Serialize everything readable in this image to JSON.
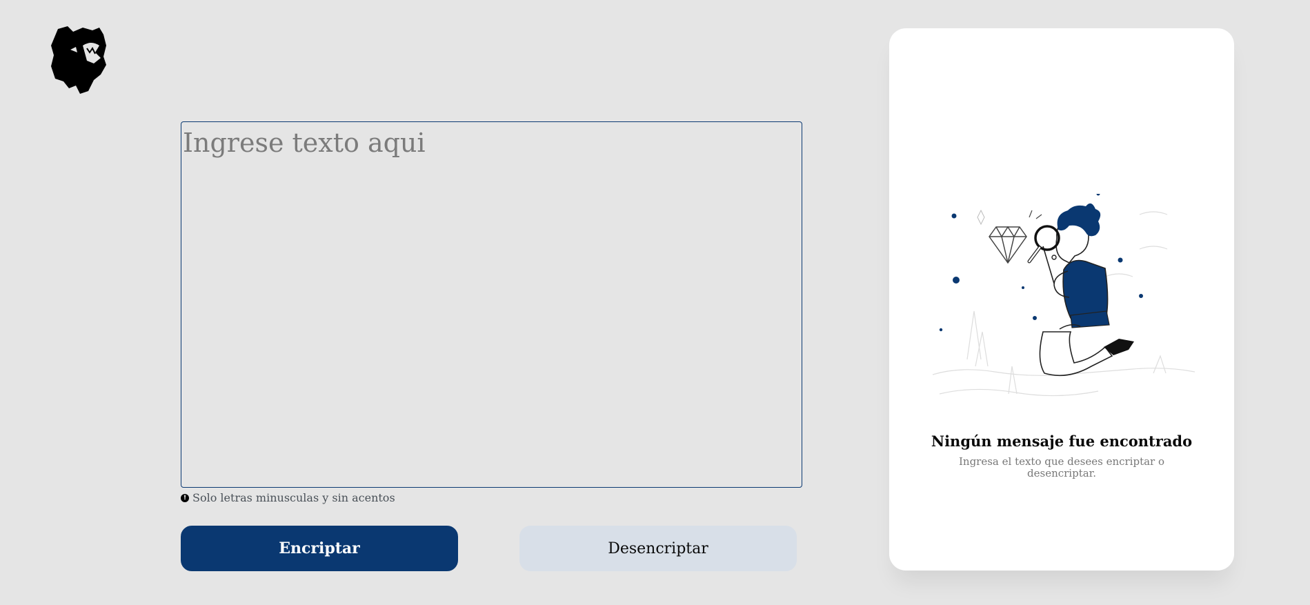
{
  "textarea": {
    "placeholder": "Ingrese texto aqui",
    "value": ""
  },
  "hint": {
    "icon": "exclamation-circle-icon",
    "text": "Solo letras minusculas y sin acentos"
  },
  "buttons": {
    "encrypt": "Encriptar",
    "decrypt": "Desencriptar"
  },
  "result_panel": {
    "title": "Ningún mensaje fue encontrado",
    "subtitle": "Ingresa el texto que desees encriptar o desencriptar."
  },
  "colors": {
    "primary": "#0a3871",
    "background": "#e5e5e5",
    "secondary_button": "#d8dfe8"
  }
}
